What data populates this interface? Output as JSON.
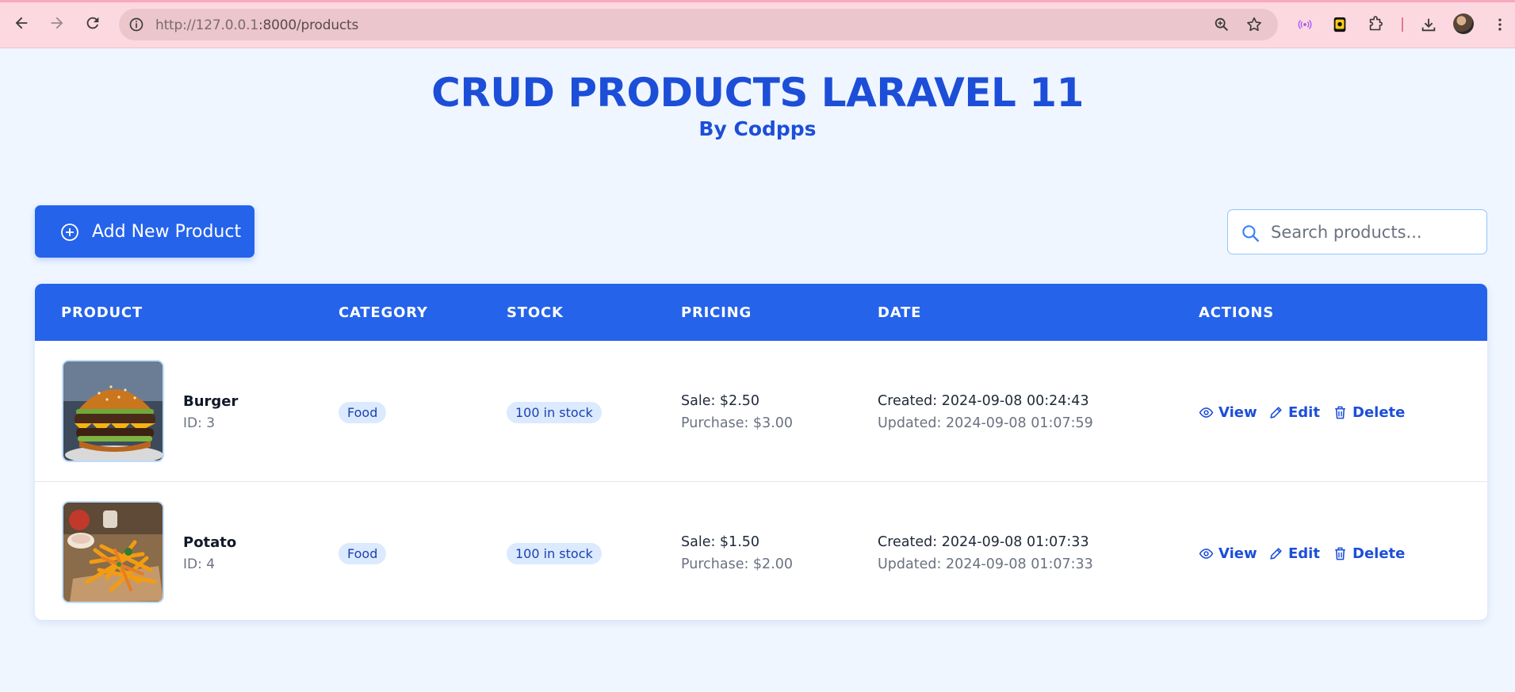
{
  "browser": {
    "url_host": "http://127.0.0.1",
    "url_rest": ":8000/products"
  },
  "page": {
    "title": "CRUD PRODUCTS LARAVEL 11",
    "subtitle": "By Codpps",
    "add_button_label": "Add New Product",
    "search_placeholder": "Search products..."
  },
  "table": {
    "headers": {
      "product": "PRODUCT",
      "category": "CATEGORY",
      "stock": "STOCK",
      "pricing": "PRICING",
      "date": "DATE",
      "actions": "ACTIONS"
    },
    "rows": [
      {
        "name": "Burger",
        "id": "ID: 3",
        "category": "Food",
        "stock": "100 in stock",
        "sale": "Sale: $2.50",
        "purchase": "Purchase: $3.00",
        "created": "Created: 2024-09-08 00:24:43",
        "updated": "Updated: 2024-09-08 01:07:59"
      },
      {
        "name": "Potato",
        "id": "ID: 4",
        "category": "Food",
        "stock": "100 in stock",
        "sale": "Sale: $1.50",
        "purchase": "Purchase: $2.00",
        "created": "Created: 2024-09-08 01:07:33",
        "updated": "Updated: 2024-09-08 01:07:33"
      }
    ],
    "actions": {
      "view": "View",
      "edit": "Edit",
      "delete": "Delete"
    }
  },
  "colors": {
    "primary": "#2563eb",
    "title": "#1d4ed8",
    "background": "#eff6ff",
    "badge_bg": "#dbeafe"
  }
}
